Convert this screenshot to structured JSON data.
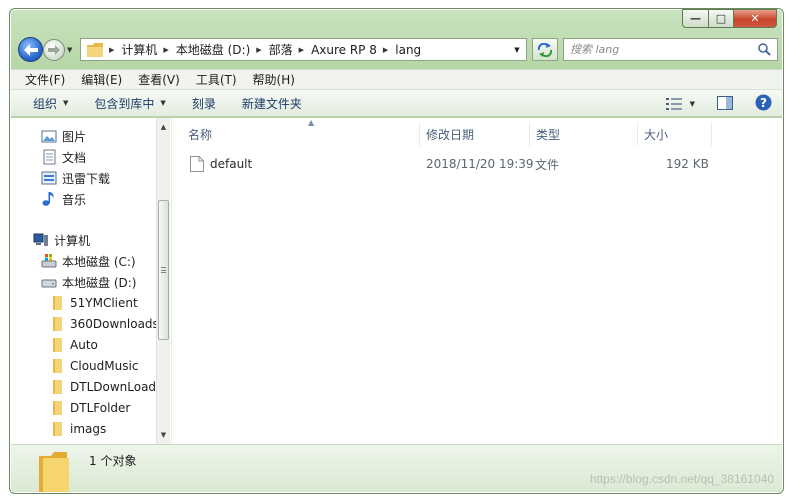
{
  "window": {
    "caption_buttons": {
      "minimize": "—",
      "maximize": "□",
      "close": "✕"
    }
  },
  "address": {
    "crumbs": [
      "计算机",
      "本地磁盘 (D:)",
      "部落",
      "Axure RP 8",
      "lang"
    ]
  },
  "search": {
    "placeholder": "搜索 lang"
  },
  "menu": [
    "文件(F)",
    "编辑(E)",
    "查看(V)",
    "工具(T)",
    "帮助(H)"
  ],
  "toolbar": {
    "organize": "组织",
    "include_in_library": "包含到库中",
    "burn": "刻录",
    "new_folder": "新建文件夹"
  },
  "nav": {
    "libraries": [
      {
        "label": "图片",
        "icon": "pictures-icon"
      },
      {
        "label": "文档",
        "icon": "documents-icon"
      },
      {
        "label": "迅雷下载",
        "icon": "thunder-download-icon"
      },
      {
        "label": "音乐",
        "icon": "music-icon"
      }
    ],
    "computer": "计算机",
    "drives": [
      "本地磁盘 (C:)",
      "本地磁盘 (D:)"
    ],
    "folders": [
      "51YMClient",
      "360Downloads",
      "Auto",
      "CloudMusic",
      "DTLDownLoads",
      "DTLFolder",
      "imags"
    ]
  },
  "columns": {
    "name": "名称",
    "modified": "修改日期",
    "type": "类型",
    "size": "大小"
  },
  "files": [
    {
      "name": "default",
      "modified": "2018/11/20 19:39",
      "type": "文件",
      "size": "192 KB"
    }
  ],
  "status": {
    "count": "1 个对象"
  },
  "watermark": "https://blog.csdn.net/qq_38161040"
}
